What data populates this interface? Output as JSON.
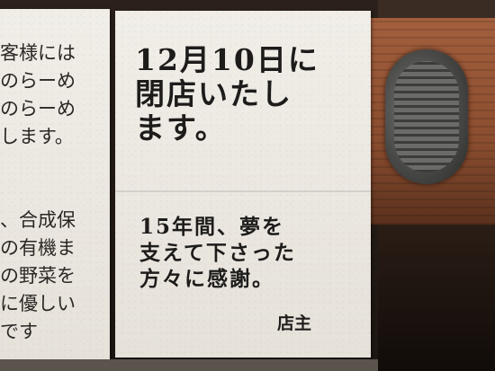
{
  "left_notice": {
    "lines": [
      "客様には",
      "のらーめ",
      "のらーめ",
      "します。",
      "、合成保",
      "の有機ま",
      "の野菜を",
      "に優しい",
      "です"
    ]
  },
  "closing_notice": {
    "headline_lines": [
      "12月10日に",
      "閉店いたし",
      "ます。"
    ],
    "message_lines": [
      "15年間、夢を",
      "支えて下さった",
      "方々に感謝。"
    ],
    "signature": "店主"
  }
}
